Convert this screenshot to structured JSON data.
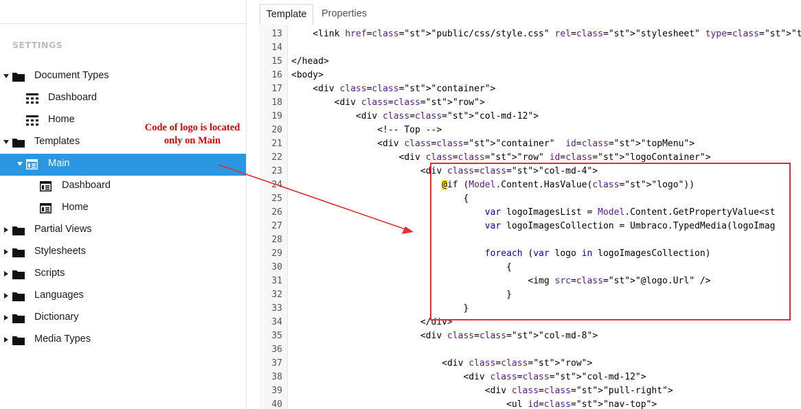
{
  "sidebar": {
    "heading": "SETTINGS",
    "items": [
      {
        "label": "Document Types",
        "icon": "folder-icon",
        "expanded": true
      },
      {
        "label": "Dashboard",
        "icon": "doctype-grid-icon"
      },
      {
        "label": "Home",
        "icon": "doctype-grid-icon"
      },
      {
        "label": "Templates",
        "icon": "folder-icon",
        "expanded": true
      },
      {
        "label": "Main",
        "icon": "template-icon",
        "expanded": true,
        "selected": true
      },
      {
        "label": "Dashboard",
        "icon": "template-icon"
      },
      {
        "label": "Home",
        "icon": "template-icon"
      },
      {
        "label": "Partial Views",
        "icon": "folder-icon",
        "expanded": false
      },
      {
        "label": "Stylesheets",
        "icon": "folder-icon",
        "expanded": false
      },
      {
        "label": "Scripts",
        "icon": "folder-icon",
        "expanded": false
      },
      {
        "label": "Languages",
        "icon": "folder-icon",
        "expanded": false
      },
      {
        "label": "Dictionary",
        "icon": "folder-icon",
        "expanded": false
      },
      {
        "label": "Media Types",
        "icon": "folder-icon",
        "expanded": false
      }
    ]
  },
  "tabs": [
    {
      "label": "Template",
      "active": true
    },
    {
      "label": "Properties",
      "active": false
    }
  ],
  "editor": {
    "lines": [
      {
        "n": "13",
        "code": "    <link href=\"public/css/style.css\" rel=\"stylesheet\" type=\"text/css\" />"
      },
      {
        "n": "14",
        "code": ""
      },
      {
        "n": "15",
        "code": "</head>"
      },
      {
        "n": "16",
        "code": "<body>"
      },
      {
        "n": "17",
        "code": "    <div class=\"container\">"
      },
      {
        "n": "18",
        "code": "        <div class=\"row\">"
      },
      {
        "n": "19",
        "code": "            <div class=\"col-md-12\">"
      },
      {
        "n": "20",
        "code": "                <!-- Top -->"
      },
      {
        "n": "21",
        "code": "                <div class=\"container\"  id=\"topMenu\">"
      },
      {
        "n": "22",
        "code": "                    <div class=\"row\" id=\"logoContainer\">"
      },
      {
        "n": "23",
        "code": "                        <div class=\"col-md-4\">"
      },
      {
        "n": "24",
        "code": "                            @if (Model.Content.HasValue(\"logo\"))"
      },
      {
        "n": "25",
        "code": "                                {"
      },
      {
        "n": "26",
        "code": "                                    var logoImagesList = Model.Content.GetPropertyValue<st"
      },
      {
        "n": "27",
        "code": "                                    var logoImagesCollection = Umbraco.TypedMedia(logoImag"
      },
      {
        "n": "28",
        "code": ""
      },
      {
        "n": "29",
        "code": "                                    foreach (var logo in logoImagesCollection)"
      },
      {
        "n": "30",
        "code": "                                        {"
      },
      {
        "n": "31",
        "code": "                                            <img src=\"@logo.Url\" />"
      },
      {
        "n": "32",
        "code": "                                        }"
      },
      {
        "n": "33",
        "code": "                                }"
      },
      {
        "n": "34",
        "code": "                        </div>"
      },
      {
        "n": "35",
        "code": "                        <div class=\"col-md-8\">"
      },
      {
        "n": "36",
        "code": ""
      },
      {
        "n": "37",
        "code": "                            <div class=\"row\">"
      },
      {
        "n": "38",
        "code": "                                <div class=\"col-md-12\">"
      },
      {
        "n": "39",
        "code": "                                    <div class=\"pull-right\">"
      },
      {
        "n": "40",
        "code": "                                        <ul id=\"nav-top\">"
      }
    ]
  },
  "annotation": {
    "text_line1": "Code of logo is located",
    "text_line2": "only on Main",
    "color": "#e00000"
  },
  "colors": {
    "selected_bg": "#2b97e3",
    "annotation_red": "#e52d2d",
    "string": "#b00020",
    "attribute": "#5a1a8a",
    "keyword": "#0000cc",
    "highlight": "#ffea00"
  }
}
